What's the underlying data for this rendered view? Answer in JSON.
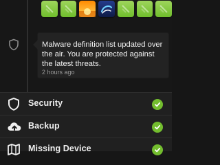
{
  "app_strip": {
    "tiles": [
      {
        "icon": "app-icon",
        "color": "#7cc242"
      },
      {
        "icon": "app-icon",
        "color": "#7cc242"
      },
      {
        "icon": "sunset-icon",
        "color": "#ff8a00"
      },
      {
        "icon": "swirl-icon",
        "color": "#1e326e"
      },
      {
        "icon": "app-icon",
        "color": "#7cc242"
      },
      {
        "icon": "app-icon",
        "color": "#7cc242"
      },
      {
        "icon": "app-icon",
        "color": "#7cc242"
      }
    ]
  },
  "notification": {
    "icon": "shield-icon",
    "message": "Malware definition list updated over the air. You are protected against the latest threats.",
    "time": "2 hours ago"
  },
  "menu": {
    "items": [
      {
        "label": "Security",
        "icon": "shield-icon",
        "status_icon": "check-icon",
        "status_color": "#73bd2e"
      },
      {
        "label": "Backup",
        "icon": "cloud-upload-icon",
        "status_icon": "check-icon",
        "status_color": "#73bd2e"
      },
      {
        "label": "Missing Device",
        "icon": "map-icon",
        "status_icon": "check-icon",
        "status_color": "#73bd2e"
      }
    ]
  }
}
